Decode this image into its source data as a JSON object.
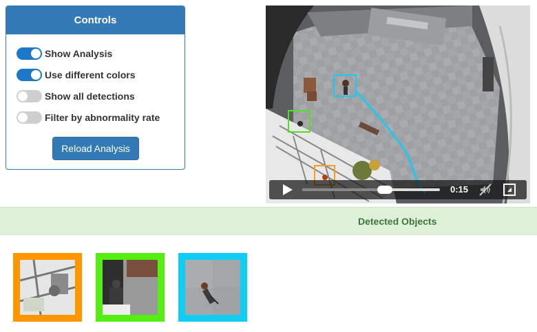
{
  "controls": {
    "title": "Controls",
    "toggles": [
      {
        "label": "Show Analysis",
        "on": true
      },
      {
        "label": "Use different colors",
        "on": true
      },
      {
        "label": "Show all detections",
        "on": false
      },
      {
        "label": "Filter by abnormality rate",
        "on": false
      }
    ],
    "reload_label": "Reload Analysis"
  },
  "video": {
    "time": "0:15",
    "progress": 0.6,
    "icons": [
      "play-icon",
      "mute-icon",
      "fullscreen-icon"
    ],
    "box_colors": {
      "blue": "#1ec8f0",
      "green": "#55dd22",
      "orange": "#ff9a1a"
    }
  },
  "detected": {
    "title": "Detected Objects",
    "thumbnails": [
      {
        "color": "#ff9600"
      },
      {
        "color": "#55ee11"
      },
      {
        "color": "#11ccf5"
      }
    ]
  }
}
